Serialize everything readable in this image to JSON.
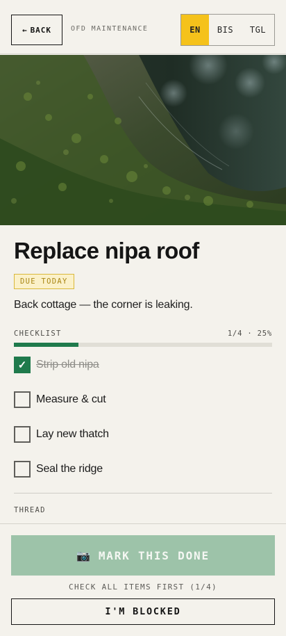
{
  "header": {
    "back_label": "BACK",
    "back_icon": "arrow-left-icon",
    "title": "OFD MAINTENANCE",
    "languages": [
      {
        "code": "EN",
        "active": true
      },
      {
        "code": "BIS",
        "active": false
      },
      {
        "code": "TGL",
        "active": false
      }
    ]
  },
  "task": {
    "title": "Replace nipa roof",
    "due_badge": "DUE TODAY",
    "description": "Back cottage — the corner is leaking."
  },
  "checklist": {
    "label": "CHECKLIST",
    "progress_text": "1/4 · 25%",
    "progress_fraction": 0.25,
    "items": [
      {
        "label": "Strip old nipa",
        "checked": true
      },
      {
        "label": "Measure & cut",
        "checked": false
      },
      {
        "label": "Lay new thatch",
        "checked": false
      },
      {
        "label": "Seal the ridge",
        "checked": false
      }
    ]
  },
  "thread": {
    "label": "THREAD"
  },
  "footer": {
    "done_icon": "camera-icon",
    "done_label": "MARK THIS DONE",
    "hint": "CHECK ALL ITEMS FIRST (1/4)",
    "blocked_label": "I'M BLOCKED"
  },
  "colors": {
    "accent_green": "#1f7a4c",
    "active_language": "#f5c21b",
    "due_badge": "#d9b83a",
    "disabled_button": "#9dc3a9"
  }
}
